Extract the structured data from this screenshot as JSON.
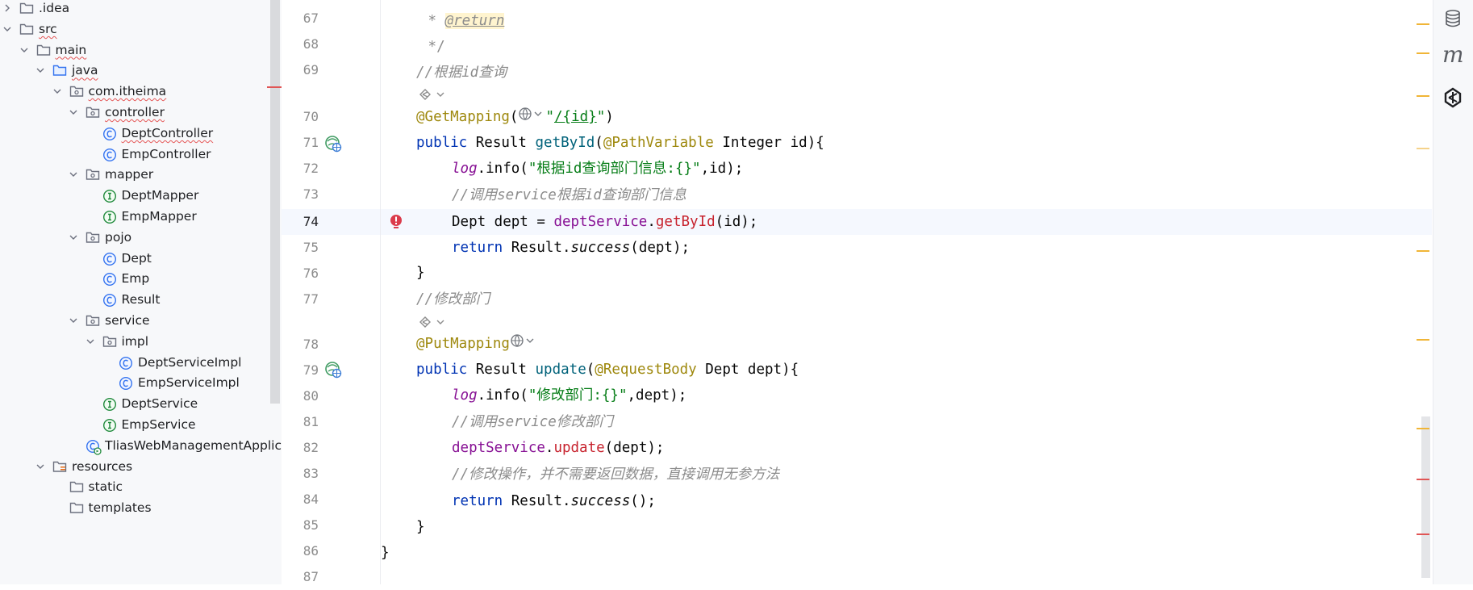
{
  "tree": {
    "items": [
      {
        "label": ".idea",
        "indent": 0,
        "type": "folder",
        "expanded": false,
        "err": false
      },
      {
        "label": "src",
        "indent": 0,
        "type": "folder",
        "expanded": true,
        "err": true
      },
      {
        "label": "main",
        "indent": 1,
        "type": "folder",
        "expanded": true,
        "err": true
      },
      {
        "label": "java",
        "indent": 2,
        "type": "folder-src",
        "expanded": true,
        "err": true
      },
      {
        "label": "com.itheima",
        "indent": 3,
        "type": "package",
        "expanded": true,
        "err": true
      },
      {
        "label": "controller",
        "indent": 4,
        "type": "package",
        "expanded": true,
        "err": true
      },
      {
        "label": "DeptController",
        "indent": 5,
        "type": "class",
        "err": true
      },
      {
        "label": "EmpController",
        "indent": 5,
        "type": "class",
        "err": false
      },
      {
        "label": "mapper",
        "indent": 4,
        "type": "package",
        "expanded": true,
        "err": false
      },
      {
        "label": "DeptMapper",
        "indent": 5,
        "type": "interface",
        "err": false
      },
      {
        "label": "EmpMapper",
        "indent": 5,
        "type": "interface",
        "err": false
      },
      {
        "label": "pojo",
        "indent": 4,
        "type": "package",
        "expanded": true,
        "err": false
      },
      {
        "label": "Dept",
        "indent": 5,
        "type": "class",
        "err": false
      },
      {
        "label": "Emp",
        "indent": 5,
        "type": "class",
        "err": false
      },
      {
        "label": "Result",
        "indent": 5,
        "type": "class",
        "err": false
      },
      {
        "label": "service",
        "indent": 4,
        "type": "package",
        "expanded": true,
        "err": false
      },
      {
        "label": "impl",
        "indent": 5,
        "type": "package",
        "expanded": true,
        "err": false
      },
      {
        "label": "DeptServiceImpl",
        "indent": 6,
        "type": "class",
        "err": false
      },
      {
        "label": "EmpServiceImpl",
        "indent": 6,
        "type": "class",
        "err": false
      },
      {
        "label": "DeptService",
        "indent": 5,
        "type": "interface",
        "err": false
      },
      {
        "label": "EmpService",
        "indent": 5,
        "type": "interface",
        "err": false
      },
      {
        "label": "TliasWebManagementApplic",
        "indent": 4,
        "type": "app",
        "err": false
      },
      {
        "label": "resources",
        "indent": 2,
        "type": "folder-res",
        "expanded": true,
        "err": false
      },
      {
        "label": "static",
        "indent": 3,
        "type": "folder",
        "err": false
      },
      {
        "label": "templates",
        "indent": 3,
        "type": "folder",
        "err": false
      }
    ]
  },
  "editor": {
    "line_numbers": [
      "67",
      "68",
      "69",
      "70",
      "71",
      "72",
      "73",
      "74",
      "75",
      "76",
      "77",
      "78",
      "79",
      "80",
      "81",
      "82",
      "83",
      "84",
      "85",
      "86",
      "87"
    ],
    "current_line": "74",
    "code": {
      "l67_star": " * ",
      "l67_tag": "@return",
      "l68": " */",
      "l69_cmt": "//根据id查询",
      "l70_ann": "@GetMapping",
      "l70_p1": "(",
      "l70_q1": "\"",
      "l70_url": "/{id}",
      "l70_q2": "\"",
      "l70_p2": ")",
      "l71_kw": "public",
      "l71_t1": " Result ",
      "l71_fn": "getById",
      "l71_p": "(",
      "l71_ann": "@PathVariable",
      "l71_rest": " Integer id){",
      "l72_fld": "log",
      "l72_dot": ".info(",
      "l72_str": "\"根据id查询部门信息:{}\"",
      "l72_rest": ",id);",
      "l73_cmt": "//调用service根据id查询部门信息",
      "l74_t": "Dept dept = ",
      "l74_fld": "deptService",
      "l74_dot": ".",
      "l74_fn": "getById",
      "l74_rest": "(id);",
      "l75_kw": "return",
      "l75_t": " Result.",
      "l75_it": "success",
      "l75_rest": "(dept);",
      "l76": "}",
      "l77_cmt": "//修改部门",
      "l78_ann": "@PutMapping",
      "l79_kw": "public",
      "l79_t1": " Result ",
      "l79_fn": "update",
      "l79_p": "(",
      "l79_ann": "@RequestBody",
      "l79_rest": " Dept dept){",
      "l80_fld": "log",
      "l80_dot": ".info(",
      "l80_str": "\"修改部门:{}\"",
      "l80_rest": ",dept);",
      "l81_cmt": "//调用service修改部门",
      "l82_fld": "deptService",
      "l82_dot": ".",
      "l82_fn": "update",
      "l82_rest": "(dept);",
      "l83_cmt": "//修改操作，并不需要返回数据，直接调用无参方法",
      "l84_kw": "return",
      "l84_t": " Result.",
      "l84_it": "success",
      "l84_rest": "();",
      "l85": "}",
      "l86": "}"
    }
  },
  "right_toolbar": {
    "icons": [
      "database-icon",
      "maven-icon",
      "ai-assistant-icon"
    ],
    "maven_letter": "m"
  },
  "colors": {
    "keyword": "#0033b3",
    "annotation": "#9e880d",
    "field": "#871094",
    "string": "#067d17",
    "comment": "#8c8c8c",
    "warning_mark": "#f0b537",
    "error_mark": "#e05555"
  }
}
